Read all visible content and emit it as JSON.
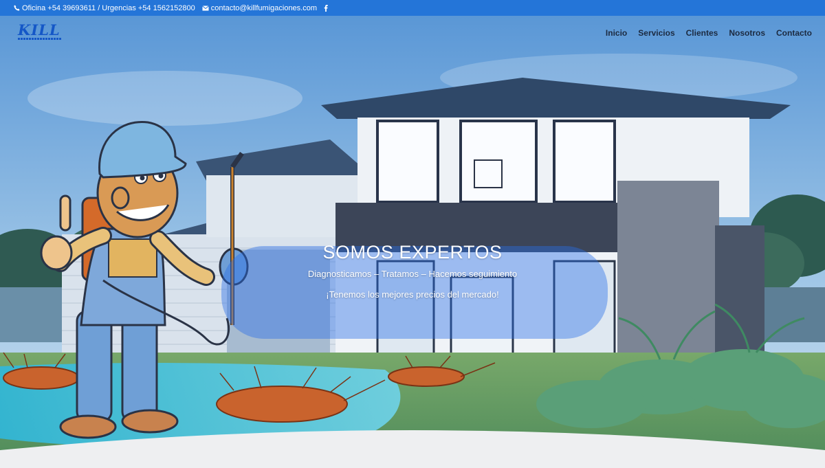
{
  "topbar": {
    "phone_icon": "phone-icon",
    "phones": "Oficina +54 39693611 / Urgencias +54 1562152800",
    "mail_icon": "envelope-icon",
    "email": "contacto@killfumigaciones.com",
    "social_icon": "facebook-icon"
  },
  "header": {
    "logo_text": "KILL",
    "nav": [
      "Inicio",
      "Servicios",
      "Clientes",
      "Nosotros",
      "Contacto"
    ]
  },
  "hero": {
    "title": "SOMOS EXPERTOS",
    "subtitle": "Diagnosticamos – Tratamos – Hacemos seguimiento",
    "price_line": "¡Tenemos los mejores precios del mercado!"
  },
  "colors": {
    "topbar": "#2475d8",
    "accent": "#1457c7",
    "nav_text": "#1c2a40",
    "banner": "#286ee6"
  }
}
